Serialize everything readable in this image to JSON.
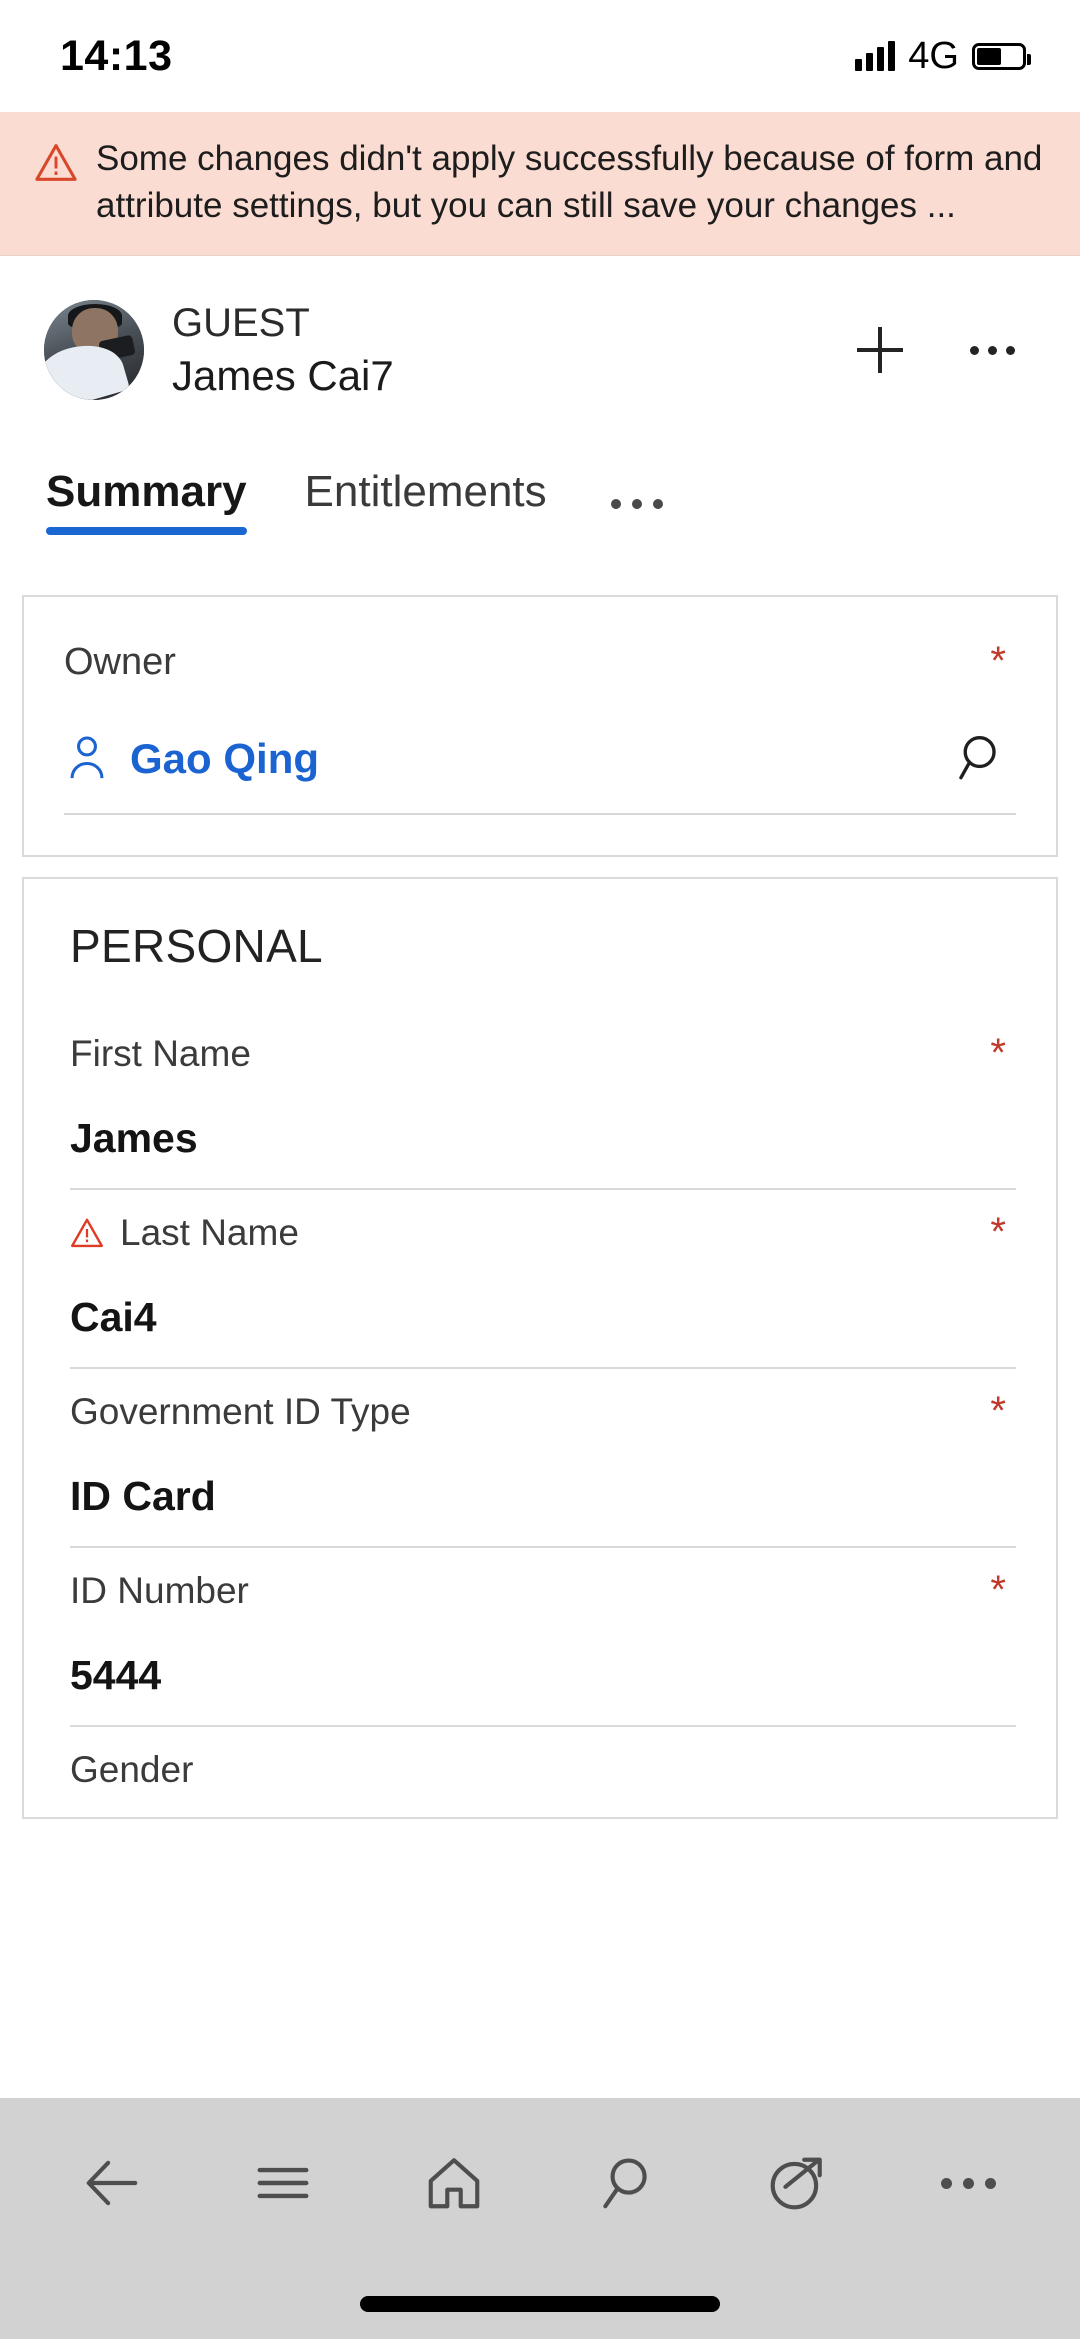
{
  "status_bar": {
    "time": "14:13",
    "network": "4G",
    "signal_icon": "signal-bars-icon",
    "battery_icon": "battery-icon",
    "battery_level_percent": 55
  },
  "error_banner": {
    "icon": "warning-triangle-icon",
    "message": "Some changes didn't apply successfully because of form and attribute settings, but you can still save your changes ...",
    "background_color": "#fadcd2",
    "icon_color": "#d9472b"
  },
  "record_header": {
    "avatar_icon": "avatar",
    "entity_type": "GUEST",
    "record_name": "James Cai7",
    "actions": [
      {
        "name": "add-button",
        "icon": "plus-icon"
      },
      {
        "name": "more-options-button",
        "icon": "ellipsis-icon"
      }
    ]
  },
  "tabs": {
    "items": [
      {
        "label": "Summary",
        "active": true
      },
      {
        "label": "Entitlements",
        "active": false
      }
    ],
    "overflow_icon": "ellipsis-icon",
    "active_underline_color": "#1867d2"
  },
  "owner_card": {
    "label": "Owner",
    "required": true,
    "required_marker": "*",
    "value": "Gao Qing",
    "value_icon": "person-icon",
    "lookup_icon": "search-icon",
    "value_color": "#1b63d0"
  },
  "personal_section": {
    "title": "PERSONAL",
    "fields": [
      {
        "label": "First Name",
        "value": "James",
        "required": true,
        "required_marker": "*",
        "has_warning": false
      },
      {
        "label": "Last Name",
        "value": "Cai4",
        "required": true,
        "required_marker": "*",
        "has_warning": true,
        "warning_icon": "warning-triangle-icon"
      },
      {
        "label": "Government ID Type",
        "value": "ID Card",
        "required": true,
        "required_marker": "*",
        "has_warning": false
      },
      {
        "label": "ID Number",
        "value": "5444",
        "required": true,
        "required_marker": "*",
        "has_warning": false
      },
      {
        "label": "Gender",
        "value": "",
        "required": false,
        "required_marker": "",
        "has_warning": false
      }
    ]
  },
  "bottom_bar": {
    "items": [
      {
        "name": "back-button",
        "icon": "arrow-left-icon"
      },
      {
        "name": "menu-button",
        "icon": "hamburger-menu-icon"
      },
      {
        "name": "home-button",
        "icon": "home-icon"
      },
      {
        "name": "search-button",
        "icon": "search-icon"
      },
      {
        "name": "assistant-button",
        "icon": "circle-arrow-icon"
      },
      {
        "name": "more-button",
        "icon": "ellipsis-icon"
      }
    ],
    "background_color": "#d2d2d2"
  }
}
